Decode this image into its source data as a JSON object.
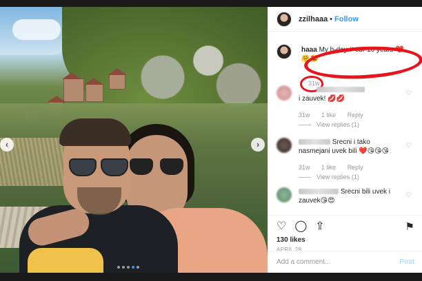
{
  "post": {
    "username": "zzilhaaa",
    "separator": "•",
    "follow_label": "Follow"
  },
  "caption": {
    "username_partial": "haaa",
    "text": " My b-day # our 10 years",
    "emoji": "❤️ 🤗🤩",
    "time": "31w"
  },
  "comments": [
    {
      "text": "i zauvek! 💋💋",
      "time": "31w",
      "likes": "1 like",
      "reply": "Reply",
      "view_replies": "View replies (1)"
    },
    {
      "text": "Srecni i tako nasmejani uvek bili ❤️😘😘😘",
      "time": "31w",
      "likes": "1 like",
      "reply": "Reply",
      "view_replies": "View replies (1)"
    },
    {
      "text": "Srecni bili uvek i zauvek😘😍"
    }
  ],
  "actions": {
    "likes": "130 likes",
    "date": "APRIL 28"
  },
  "add_comment": {
    "placeholder": "Add a comment...",
    "post_label": "Post"
  },
  "icons": {
    "heart": "♡",
    "comment": "◯",
    "share": "⇪",
    "save": "⚑",
    "prev": "‹",
    "next": "›"
  },
  "colors": {
    "follow": "#3897f0",
    "annotation_red": "#e8141b",
    "post_disabled": "#b3dbff"
  }
}
